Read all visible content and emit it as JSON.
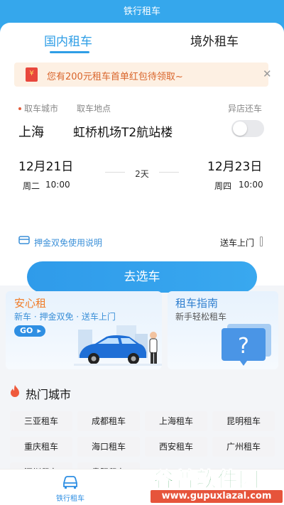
{
  "app": {
    "title": "铁行租车"
  },
  "tabs": [
    {
      "label": "国内租车",
      "active": true
    },
    {
      "label": "境外租车",
      "active": false
    }
  ],
  "promo": {
    "icon_text": "¥",
    "text": "您有200元租车首单红包待领取~",
    "close": "✕"
  },
  "booking": {
    "pickup_city_label": "取车城市",
    "pickup_location_label": "取车地点",
    "return_elsewhere_label": "异店还车",
    "city": "上海",
    "location": "虹桥机场T2航站楼",
    "return_elsewhere_on": false,
    "start_date": "12月21日",
    "start_day": "周二",
    "start_time": "10:00",
    "duration": "2天",
    "end_date": "12月23日",
    "end_day": "周四",
    "end_time": "10:00",
    "deposit_text": "押金双免使用说明",
    "delivery_label": "送车上门",
    "cta": "去选车"
  },
  "features": {
    "left": {
      "title": "安心租",
      "subtitle": "新车 · 押金双免 · 送车上门",
      "go_label": "GO"
    },
    "right": {
      "title": "租车指南",
      "subtitle": "新手轻松租车",
      "icon_glyph": "?"
    }
  },
  "hot_cities": {
    "title": "热门城市",
    "items": [
      "三亚租车",
      "成都租车",
      "上海租车",
      "昆明租车",
      "重庆租车",
      "海口租车",
      "西安租车",
      "广州租车",
      "深圳租车",
      "贵阳租车"
    ]
  },
  "bottom_nav": {
    "item_label": "铁行租车"
  },
  "watermark": {
    "main": "谷普软件园",
    "url": "www.gupuxlazal.com"
  },
  "colors": {
    "primary": "#35a7ec",
    "accent": "#f07c28",
    "promo_text": "#d9642a",
    "watermark_green": "#2a9a4d",
    "watermark_red": "#e6543b"
  }
}
